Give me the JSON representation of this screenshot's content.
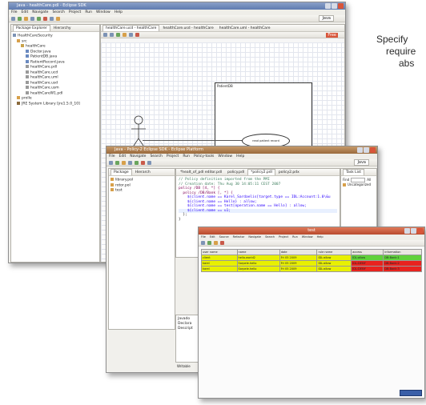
{
  "side_text": {
    "line1": "Specify",
    "line2": "require",
    "line3": "abs"
  },
  "win1": {
    "title": "Java - healthCare.pdl - Eclipse SDK",
    "menu": [
      "File",
      "Edit",
      "Navigate",
      "Search",
      "Project",
      "Run",
      "Window",
      "Help"
    ],
    "perspective": "Java",
    "left_tabs": [
      "Package Explorer",
      "Hierarchy"
    ],
    "tree": [
      "HealthCareSecurity",
      "src",
      "healthCare",
      "Doctor.java",
      "PatientDB.java",
      "RatientRecord.java",
      "healthCare.pdl",
      "healthCare.ucd",
      "healthCare.uml",
      "healthCare.usd",
      "healthCare.usm",
      "healthCareW1.pdl",
      "prolle",
      "JRE System Library [jre1.5.0_10]"
    ],
    "editor_tabs": [
      "healthCare.ucd - healthCare",
      "healthCare.usd - healthCare",
      "healthCare.uml - healthCare"
    ],
    "palette_label": "Free",
    "diagram": {
      "system": "PatientDB",
      "actor": "doctor",
      "usecase": "read patient record"
    }
  },
  "win2": {
    "title": "Java - Policy-2 Eclipse SDK - Eclipse Platform",
    "menu": [
      "File",
      "Edit",
      "Navigate",
      "Search",
      "Project",
      "Run",
      "Policy-tools",
      "Window",
      "Help"
    ],
    "perspective": "Java",
    "left_tabs": [
      "Package",
      "Hierarch"
    ],
    "tree": [
      "library.pol",
      "rotor.pol",
      "test"
    ],
    "editor_tabs": [
      "*healt_of_pdl editor.pdl",
      "policy.pdl",
      "*policy2.pdl",
      "policy2.pdx"
    ],
    "code": [
      "// Policy definition imported from the PMI",
      "// Creation date: Thu Aug 30 14:05:11 CEST 2007",
      "",
      "policy /DB [4, *] {",
      "  policy /DB/Bank [, *] {",
      "    ${client.name == Karel_Sardaelis[target.type == IDL:Account:1.0\\&u",
      "    ${client.name == Hello} : allow;",
      "    ${client.name == test[operation.name == Hello] : allow;",
      "    ${client.name == u1;",
      "  };",
      "}"
    ],
    "right_tabs": [
      "Task List"
    ],
    "find_label": "Find",
    "all_label": "All",
    "uncategorized": "Uncategorized",
    "outline_tab": "Outline",
    "bottom_tabs": [
      "Javado",
      "Declara",
      "Descript"
    ],
    "bottom_label": "Writable"
  },
  "win3": {
    "title": "test",
    "menu": [
      "File",
      "Edit",
      "Source",
      "Refactor",
      "Navigate",
      "Search",
      "Project",
      "Run",
      "Window",
      "Help"
    ],
    "columns": [
      "user name",
      "name",
      "date",
      "rule name",
      "access",
      "information"
    ],
    "rows": [
      {
        "cells": [
          "client",
          "hello.world2",
          "Fri 05 2009",
          "IDL:allow",
          "IDL:allow",
          "DB:Bank:1"
        ],
        "color": "#e8f000"
      },
      {
        "cells": [
          "karel",
          "Sarpele.hello",
          "Fri 05 2009",
          "IDL:allow",
          "IDL:DENY",
          "DB:Bank:2"
        ],
        "color": "#e8f000"
      },
      {
        "cells": [
          "karel",
          "Sarpele.hello",
          "Fri 05 2009",
          "IDL:allow",
          "IDL:DENY",
          "DB:Bank:3"
        ],
        "color": "#e8f000"
      }
    ],
    "row_tail_colors": [
      "#5fd13a",
      "#e8231f",
      "#e8231f"
    ]
  }
}
